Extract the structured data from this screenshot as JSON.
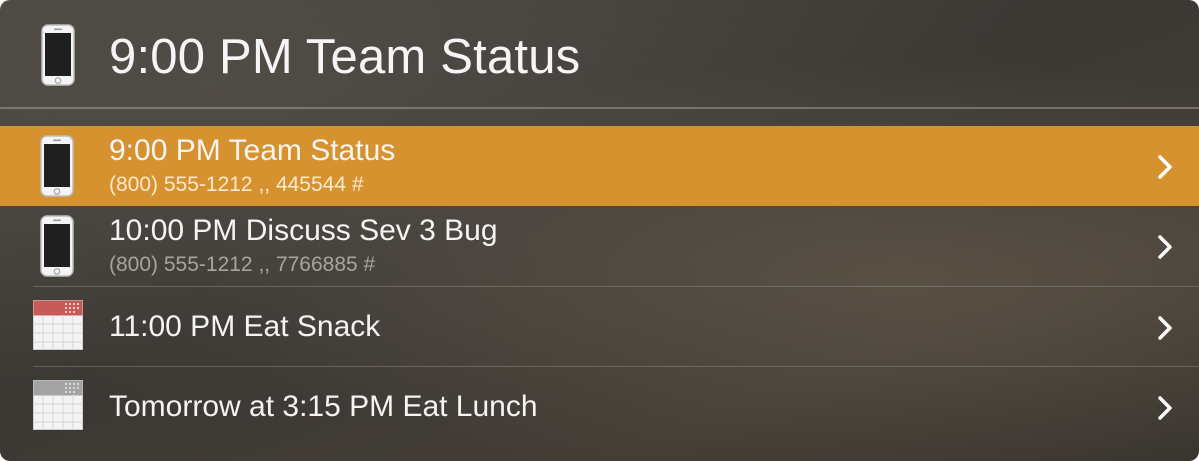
{
  "header": {
    "title": "9:00 PM Team Status",
    "icon": "phone-icon"
  },
  "results": [
    {
      "title": "9:00 PM Team Status",
      "subtitle": "(800) 555-1212 ,, 445544 #",
      "icon": "phone-icon",
      "selected": true
    },
    {
      "title": "10:00 PM Discuss Sev 3 Bug",
      "subtitle": "(800) 555-1212 ,, 7766885 #",
      "icon": "phone-icon",
      "selected": false
    },
    {
      "title": "11:00 PM Eat Snack",
      "icon": "calendar-icon",
      "calendar_color": "red",
      "selected": false
    },
    {
      "title": "Tomorrow at 3:15 PM Eat Lunch",
      "icon": "calendar-icon",
      "calendar_color": "gray",
      "selected": false
    }
  ],
  "colors": {
    "selection": "#d6922e",
    "background": "#3f3b36",
    "text": "#f4f4f4",
    "subtitle": "#a7a39e",
    "calendar_red": "#c75b57",
    "calendar_gray": "#a3a3a3"
  }
}
